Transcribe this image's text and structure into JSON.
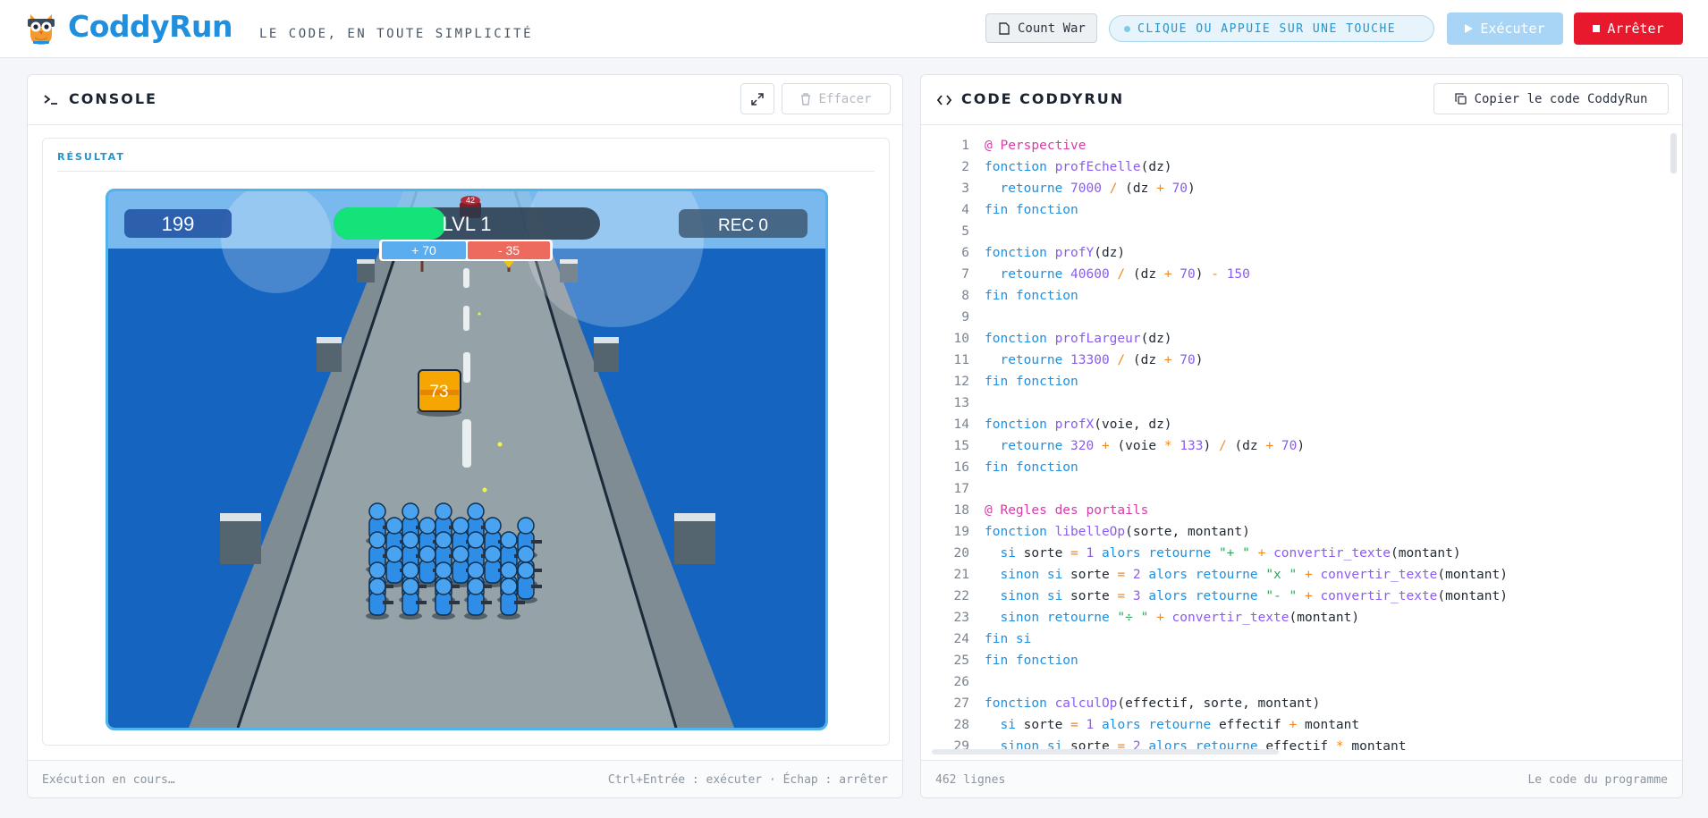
{
  "header": {
    "brand": "CoddyRun",
    "tagline": "LE CODE, EN TOUTE SIMPLICITÉ",
    "project_name": "Count War",
    "status_text": "CLIQUE OU APPUIE SUR UNE TOUCHE",
    "run_label": "Exécuter",
    "stop_label": "Arrêter"
  },
  "console": {
    "title": "CONSOLE",
    "clear_label": "Effacer",
    "result_label": "RÉSULTAT",
    "footer_left": "Exécution en cours…",
    "footer_right": "Ctrl+Entrée : exécuter · Échap : arrêter",
    "game": {
      "count": "199",
      "level": "LVL 1",
      "record": "REC 0",
      "gate_plus": "+ 70",
      "gate_minus": "- 35",
      "enemy_count": "42",
      "crate_value": "73"
    }
  },
  "editor": {
    "title": "CODE CODDYRUN",
    "copy_label": "Copier le code CoddyRun",
    "footer_left": "462 lignes",
    "footer_right": "Le code du programme",
    "lines": [
      [
        [
          "cm",
          "@ Perspective"
        ]
      ],
      [
        [
          "kw",
          "fonction "
        ],
        [
          "fn",
          "profEchelle"
        ],
        [
          "tx",
          "(dz)"
        ]
      ],
      [
        [
          "tx",
          "  "
        ],
        [
          "kw",
          "retourne "
        ],
        [
          "nm",
          "7000"
        ],
        [
          "op",
          " / "
        ],
        [
          "tx",
          "(dz "
        ],
        [
          "op",
          "+ "
        ],
        [
          "nm",
          "70"
        ],
        [
          "tx",
          ")"
        ]
      ],
      [
        [
          "kw",
          "fin fonction"
        ]
      ],
      [],
      [
        [
          "kw",
          "fonction "
        ],
        [
          "fn",
          "profY"
        ],
        [
          "tx",
          "(dz)"
        ]
      ],
      [
        [
          "tx",
          "  "
        ],
        [
          "kw",
          "retourne "
        ],
        [
          "nm",
          "40600"
        ],
        [
          "op",
          " / "
        ],
        [
          "tx",
          "(dz "
        ],
        [
          "op",
          "+ "
        ],
        [
          "nm",
          "70"
        ],
        [
          "tx",
          ") "
        ],
        [
          "op",
          "- "
        ],
        [
          "nm",
          "150"
        ]
      ],
      [
        [
          "kw",
          "fin fonction"
        ]
      ],
      [],
      [
        [
          "kw",
          "fonction "
        ],
        [
          "fn",
          "profLargeur"
        ],
        [
          "tx",
          "(dz)"
        ]
      ],
      [
        [
          "tx",
          "  "
        ],
        [
          "kw",
          "retourne "
        ],
        [
          "nm",
          "13300"
        ],
        [
          "op",
          " / "
        ],
        [
          "tx",
          "(dz "
        ],
        [
          "op",
          "+ "
        ],
        [
          "nm",
          "70"
        ],
        [
          "tx",
          ")"
        ]
      ],
      [
        [
          "kw",
          "fin fonction"
        ]
      ],
      [],
      [
        [
          "kw",
          "fonction "
        ],
        [
          "fn",
          "profX"
        ],
        [
          "tx",
          "(voie, dz)"
        ]
      ],
      [
        [
          "tx",
          "  "
        ],
        [
          "kw",
          "retourne "
        ],
        [
          "nm",
          "320"
        ],
        [
          "op",
          " + "
        ],
        [
          "tx",
          "(voie "
        ],
        [
          "op",
          "* "
        ],
        [
          "nm",
          "133"
        ],
        [
          "tx",
          ") "
        ],
        [
          "op",
          "/ "
        ],
        [
          "tx",
          "(dz "
        ],
        [
          "op",
          "+ "
        ],
        [
          "nm",
          "70"
        ],
        [
          "tx",
          ")"
        ]
      ],
      [
        [
          "kw",
          "fin fonction"
        ]
      ],
      [],
      [
        [
          "cm",
          "@ Regles des portails"
        ]
      ],
      [
        [
          "kw",
          "fonction "
        ],
        [
          "fn",
          "libelleOp"
        ],
        [
          "tx",
          "(sorte, montant)"
        ]
      ],
      [
        [
          "tx",
          "  "
        ],
        [
          "kw",
          "si "
        ],
        [
          "tx",
          "sorte "
        ],
        [
          "op",
          "= "
        ],
        [
          "nm",
          "1 "
        ],
        [
          "kw",
          "alors retourne "
        ],
        [
          "st",
          "\"+ \""
        ],
        [
          "op",
          " + "
        ],
        [
          "fn",
          "convertir_texte"
        ],
        [
          "tx",
          "(montant)"
        ]
      ],
      [
        [
          "tx",
          "  "
        ],
        [
          "kw",
          "sinon si "
        ],
        [
          "tx",
          "sorte "
        ],
        [
          "op",
          "= "
        ],
        [
          "nm",
          "2 "
        ],
        [
          "kw",
          "alors retourne "
        ],
        [
          "st",
          "\"x \""
        ],
        [
          "op",
          " + "
        ],
        [
          "fn",
          "convertir_texte"
        ],
        [
          "tx",
          "(montant)"
        ]
      ],
      [
        [
          "tx",
          "  "
        ],
        [
          "kw",
          "sinon si "
        ],
        [
          "tx",
          "sorte "
        ],
        [
          "op",
          "= "
        ],
        [
          "nm",
          "3 "
        ],
        [
          "kw",
          "alors retourne "
        ],
        [
          "st",
          "\"- \""
        ],
        [
          "op",
          " + "
        ],
        [
          "fn",
          "convertir_texte"
        ],
        [
          "tx",
          "(montant)"
        ]
      ],
      [
        [
          "tx",
          "  "
        ],
        [
          "kw",
          "sinon retourne "
        ],
        [
          "st",
          "\"÷ \""
        ],
        [
          "op",
          " + "
        ],
        [
          "fn",
          "convertir_texte"
        ],
        [
          "tx",
          "(montant)"
        ]
      ],
      [
        [
          "kw",
          "fin si"
        ]
      ],
      [
        [
          "kw",
          "fin fonction"
        ]
      ],
      [],
      [
        [
          "kw",
          "fonction "
        ],
        [
          "fn",
          "calculOp"
        ],
        [
          "tx",
          "(effectif, sorte, montant)"
        ]
      ],
      [
        [
          "tx",
          "  "
        ],
        [
          "kw",
          "si "
        ],
        [
          "tx",
          "sorte "
        ],
        [
          "op",
          "= "
        ],
        [
          "nm",
          "1 "
        ],
        [
          "kw",
          "alors retourne "
        ],
        [
          "tx",
          "effectif "
        ],
        [
          "op",
          "+ "
        ],
        [
          "tx",
          "montant"
        ]
      ],
      [
        [
          "tx",
          "  "
        ],
        [
          "kw",
          "sinon si "
        ],
        [
          "tx",
          "sorte "
        ],
        [
          "op",
          "= "
        ],
        [
          "nm",
          "2 "
        ],
        [
          "kw",
          "alors retourne "
        ],
        [
          "tx",
          "effectif "
        ],
        [
          "op",
          "* "
        ],
        [
          "tx",
          "montant"
        ]
      ]
    ]
  },
  "colors": {
    "brand": "#1f8fde",
    "stop": "#e8192c",
    "run_disabled": "#a8d5f5",
    "sea": "#1565c0",
    "soldier": "#2e8de6",
    "gate_plus": "#5aaef0",
    "gate_minus": "#ec6a5e"
  }
}
